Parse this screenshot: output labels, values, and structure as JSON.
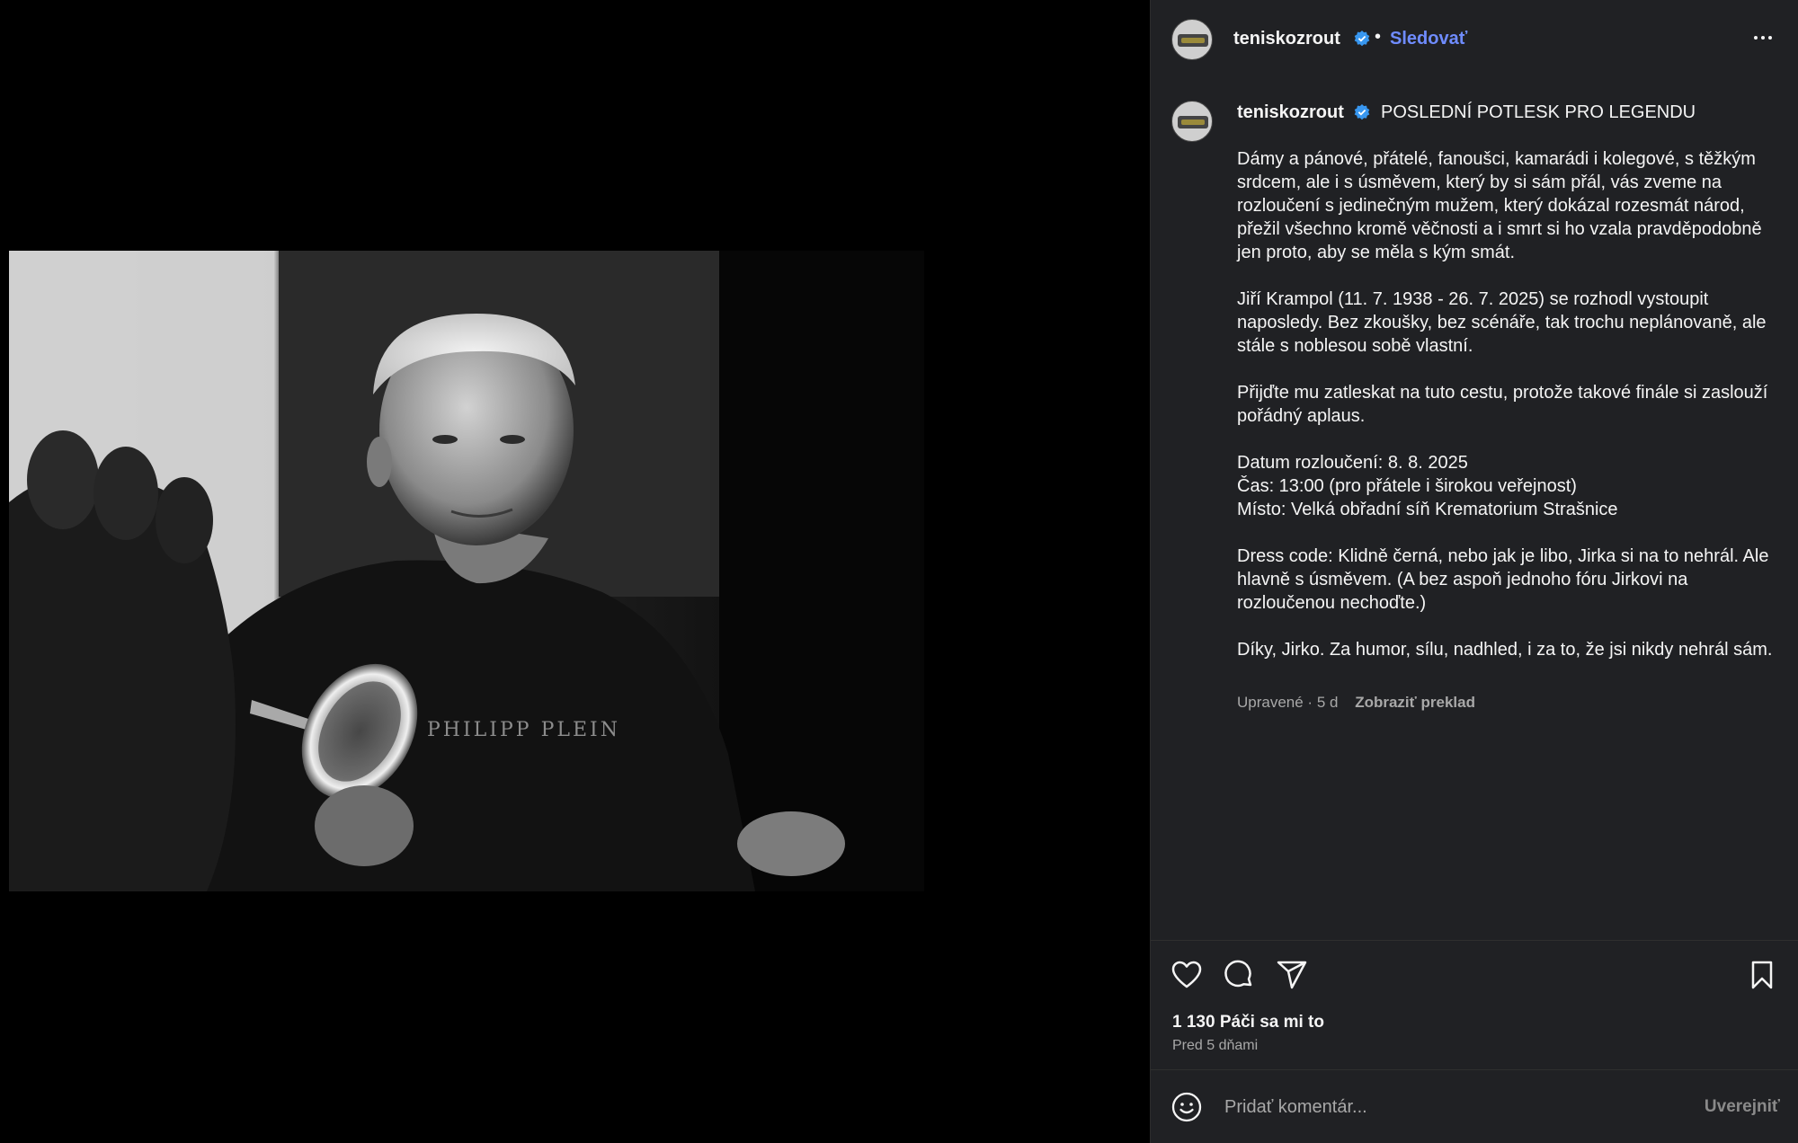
{
  "post": {
    "username": "teniskozrout",
    "follow_label": "Sledovať",
    "header_dot": "•",
    "caption_title": "POSLEDNÍ POTLESK PRO LEGENDU",
    "caption_paragraphs": [
      "Dámy a pánové, přátelé, fanoušci, kamarádi i kolegové, s těžkým srdcem, ale i s úsměvem, který by si sám přál, vás zveme na rozloučení s jedinečným mužem, který dokázal rozesmát národ, přežil všechno kromě věčnosti a i smrt si ho vzala pravděpodobně jen proto, aby se měla s kým smát.",
      "Jiří Krampol (11. 7. 1938 - 26. 7. 2025) se rozhodl vystoupit naposledy. Bez zkoušky, bez scénáře, tak trochu neplánovaně, ale stále s noblesou sobě vlastní.",
      "Přijďte mu zatleskat na tuto cestu, protože takové finále si zaslouží pořádný aplaus.",
      "Datum rozloučení: 8. 8. 2025",
      "Čas: 13:00 (pro přátele i širokou veřejnost)",
      "Místo: Velká obřadní síň Krematorium Strašnice",
      "Dress code: Klidně černá, nebo jak je libo, Jirka si na to nehrál. Ale hlavně s úsměvem. (A bez aspoň jednoho fóru Jirkovi na rozloučenou nechoďte.)",
      "Díky, Jirko. Za humor, sílu, nadhled, i za to, že jsi nikdy nehrál sám."
    ],
    "meta_edited": "Upravené · 5 d",
    "translate_label": "Zobraziť preklad",
    "likes_text": "1 130 Páči sa mi to",
    "time_ago": "Pred 5 dňami",
    "comment_placeholder": "Pridať komentár...",
    "post_label": "Uverejniť",
    "photo_shirt_text": "PHILIPP PLEIN"
  },
  "icons": {
    "verified": "verified-badge-icon",
    "more": "more-options-icon",
    "like": "heart-icon",
    "comment": "comment-bubble-icon",
    "share": "paper-plane-icon",
    "bookmark": "bookmark-icon",
    "emoji": "smiley-icon"
  },
  "colors": {
    "panel_bg": "#202124",
    "follow": "#6f8cff",
    "verified": "#3897f0",
    "muted": "#a8a8a8"
  }
}
